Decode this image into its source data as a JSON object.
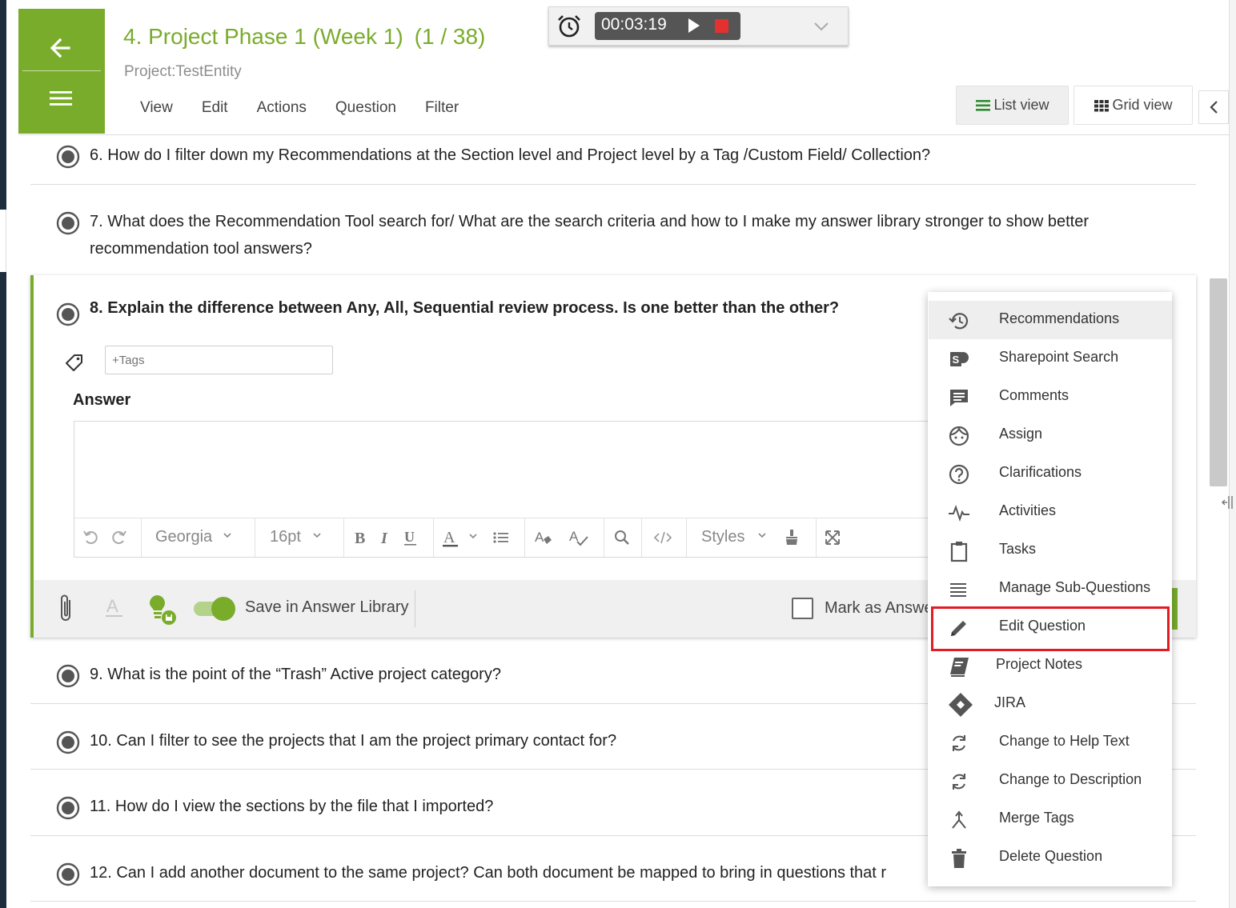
{
  "header": {
    "title": "4. Project Phase 1 (Week 1)",
    "count": "(1 / 38)",
    "subtitle": "Project:TestEntity",
    "menu": [
      "View",
      "Edit",
      "Actions",
      "Question",
      "Filter"
    ],
    "back_icon": "arrow-left-icon",
    "menu_icon": "hamburger-icon"
  },
  "timer": {
    "time": "00:03:19",
    "alarm_icon": "alarm-clock-icon",
    "play_icon": "play-icon",
    "stop_icon": "stop-icon",
    "stop_color": "#e53030"
  },
  "views": {
    "list_label": "List view",
    "grid_label": "Grid view",
    "collapse_icon": "chevron-left-icon"
  },
  "questions": {
    "q6": "6. How do I filter down my Recommendations at the Section level and Project level by a Tag /Custom Field/ Collection?",
    "q7_line1": "7. What does the Recommendation Tool search for/ What are the search criteria and how to I make my answer library stronger to show better",
    "q7_line2": "recommendation tool answers?",
    "q8": "8. Explain the difference between Any, All, Sequential review process. Is one better than the other?",
    "q9": "9. What is the point of the “Trash” Active project category?",
    "q10": "10. Can I filter to see the projects that I am the project primary contact for?",
    "q11": "11. How do I view the sections by the file that I imported?",
    "q12": "12. Can I add another document to the same project? Can both document be mapped to bring in questions that r"
  },
  "card": {
    "tags_placeholder": "+Tags",
    "answer_label": "Answer",
    "font_family": "Georgia",
    "font_size": "16pt",
    "styles_label": "Styles",
    "save_library_label": "Save in Answer Library",
    "save_library_on": true,
    "mark_label": "Mark as Answe",
    "accent_color": "#7aac2c"
  },
  "dropdown": {
    "items": [
      {
        "label": "Recommendations",
        "icon": "history-icon"
      },
      {
        "label": "Sharepoint Search",
        "icon": "sharepoint-icon"
      },
      {
        "label": "Comments",
        "icon": "comment-icon"
      },
      {
        "label": "Assign",
        "icon": "face-icon"
      },
      {
        "label": "Clarifications",
        "icon": "help-circle-icon"
      },
      {
        "label": "Activities",
        "icon": "pulse-icon"
      },
      {
        "label": "Tasks",
        "icon": "clipboard-icon"
      },
      {
        "label": "Manage Sub-Questions",
        "icon": "lines-icon"
      },
      {
        "label": "Edit Question",
        "icon": "pencil-icon"
      },
      {
        "label": "Project Notes",
        "icon": "book-icon"
      },
      {
        "label": "JIRA",
        "icon": "jira-icon"
      },
      {
        "label": "Change to Help Text",
        "icon": "refresh-icon"
      },
      {
        "label": "Change to Description",
        "icon": "refresh-icon"
      },
      {
        "label": "Merge Tags",
        "icon": "merge-icon"
      },
      {
        "label": "Delete Question",
        "icon": "trash-icon"
      }
    ],
    "highlight_color": "#e31b23"
  }
}
